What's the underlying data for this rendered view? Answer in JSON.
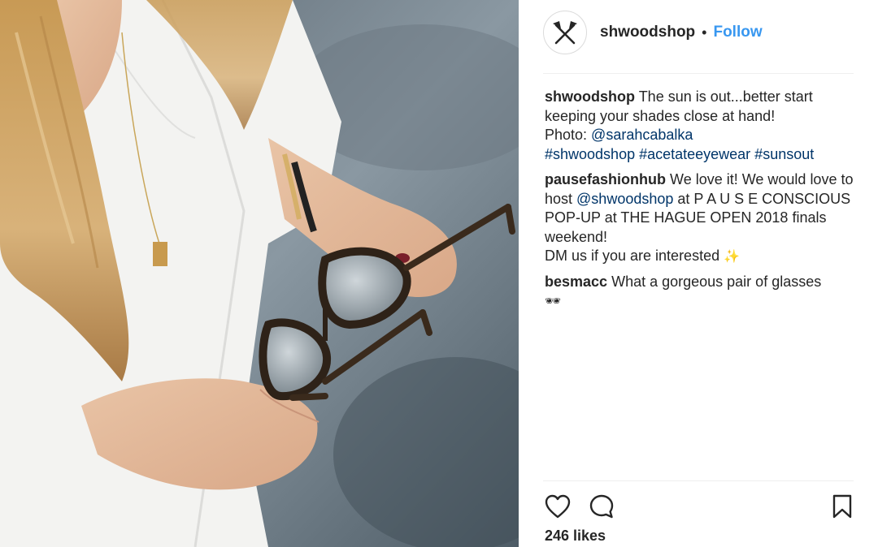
{
  "post": {
    "image": {
      "description_icon": "photo-icon"
    },
    "header": {
      "username": "shwoodshop",
      "separator": "•",
      "follow_label": "Follow",
      "avatar_icon": "crossed-axes-icon"
    },
    "caption": {
      "author": "shwoodshop",
      "text": "The sun is out...better start keeping your shades close at hand!",
      "photo_prefix": "Photo: ",
      "photo_credit": "@sarahcabalka",
      "hashtags": "#shwoodshop #acetateeyewear #sunsout"
    },
    "comments": [
      {
        "author": "pausefashionhub",
        "text_1": "We love it! We would love to host ",
        "mention": "@shwoodshop",
        "text_2": " at P A U S E CONSCIOUS POP-UP at THE HAGUE OPEN 2018 finals weekend!\nDM us if you are interested ",
        "emoji": "✨"
      },
      {
        "author": "besmacc",
        "text": "What a gorgeous pair of glasses",
        "emoji": "🕶"
      }
    ],
    "actions": {
      "like_icon": "heart-icon",
      "comment_icon": "comment-icon",
      "save_icon": "bookmark-icon"
    },
    "likes_label": "246 likes",
    "colors": {
      "link": "#003569",
      "follow": "#3897f0",
      "text": "#262626",
      "divider": "#efefef"
    }
  }
}
